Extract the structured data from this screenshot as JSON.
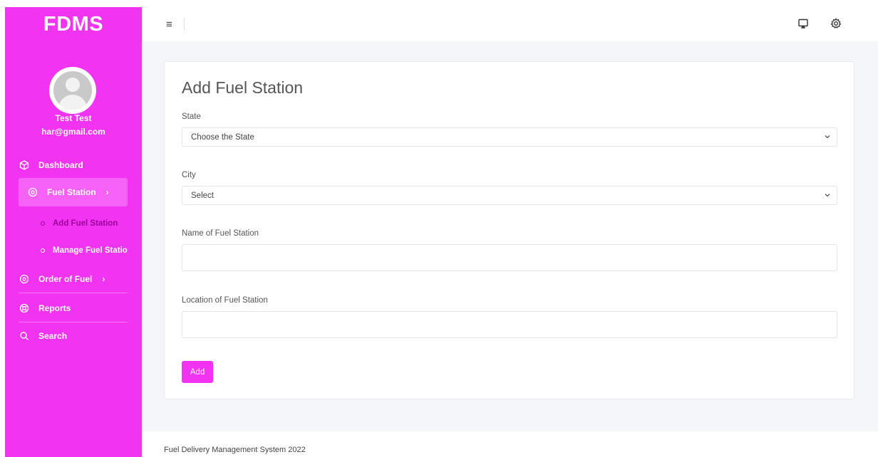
{
  "app": {
    "brand": "FDMS"
  },
  "user": {
    "name": "Test Test",
    "email": "har@gmail.com"
  },
  "sidebar": {
    "items": [
      {
        "label": "Dashboard",
        "icon": "cube-icon"
      },
      {
        "label": "Fuel Station",
        "icon": "target-icon",
        "chevron": "›",
        "active": true
      },
      {
        "label": "Order of Fuel",
        "icon": "target-icon",
        "chevron": "›"
      },
      {
        "label": "Reports",
        "icon": "lifebuoy-icon"
      },
      {
        "label": "Search",
        "icon": "search-icon"
      }
    ],
    "subitems": [
      {
        "label": "Add Fuel Station",
        "current": true
      },
      {
        "label": "Manage Fuel Statio",
        "current": false
      }
    ]
  },
  "header": {
    "menu_icon": "≡"
  },
  "form": {
    "title": "Add Fuel Station",
    "state": {
      "label": "State",
      "value": "Choose the State"
    },
    "city": {
      "label": "City",
      "value": "Select"
    },
    "name": {
      "label": "Name of Fuel Station",
      "value": ""
    },
    "location": {
      "label": "Location of Fuel Station",
      "value": ""
    },
    "submit_label": "Add"
  },
  "footer": {
    "text": "Fuel Delivery Management System 2022"
  },
  "colors": {
    "accent": "#f233f2",
    "active_item": "#f562f5",
    "current_subitem": "#9b009b"
  }
}
